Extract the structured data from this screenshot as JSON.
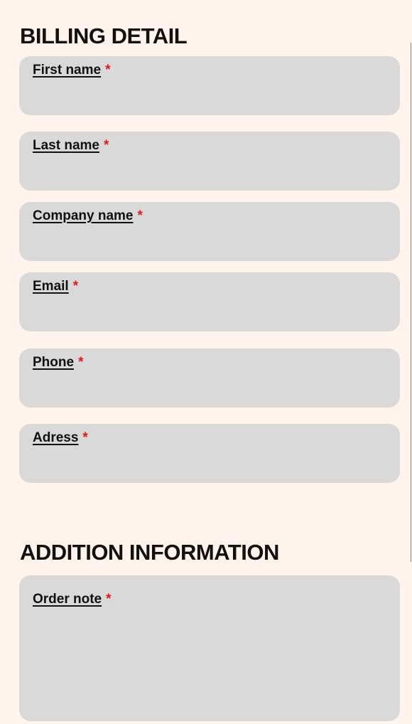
{
  "billing": {
    "title": "BILLING DETAIL",
    "fields": [
      {
        "label": "First name",
        "required_mark": "*",
        "value": ""
      },
      {
        "label": "Last name",
        "required_mark": "*",
        "value": ""
      },
      {
        "label": "Company name",
        "required_mark": "*",
        "value": ""
      },
      {
        "label": "Email",
        "required_mark": "*",
        "value": ""
      },
      {
        "label": "Phone",
        "required_mark": "*",
        "value": ""
      },
      {
        "label": "Adress",
        "required_mark": "*",
        "value": ""
      }
    ]
  },
  "additional": {
    "title": "ADDITION INFORMATION",
    "order_note": {
      "label": "Order note",
      "required_mark": "*",
      "value": ""
    }
  },
  "colors": {
    "background": "#FFF3EB",
    "field_background": "#D9D9D9",
    "required": "#E01919",
    "text": "#111111"
  }
}
